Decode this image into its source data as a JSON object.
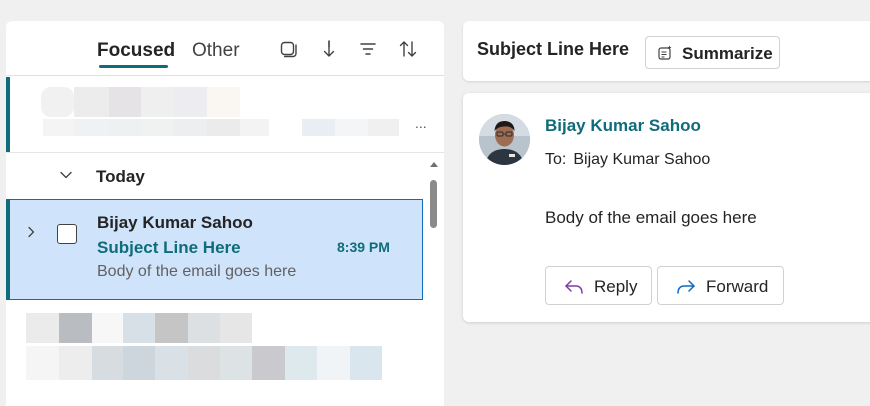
{
  "list": {
    "tabs": [
      {
        "label": "Focused",
        "active": true
      },
      {
        "label": "Other",
        "active": false
      }
    ],
    "toolbar_icons": [
      "select-mode-icon",
      "jump-down-icon",
      "filter-icon",
      "sort-icon"
    ],
    "group": {
      "label": "Today",
      "expanded": true
    },
    "selected_message": {
      "sender": "Bijay Kumar Sahoo",
      "subject": "Subject Line Here",
      "time": "8:39 PM",
      "preview": "Body of the email goes here"
    },
    "blurred_preview_more": "..."
  },
  "reading_pane": {
    "subject": "Subject Line Here",
    "summarize_label": "Summarize",
    "sender": "Bijay Kumar Sahoo",
    "to_label": "To:",
    "to_value": "Bijay Kumar Sahoo",
    "body": "Body of the email goes here",
    "reply_label": "Reply",
    "forward_label": "Forward"
  },
  "colors": {
    "accent": "#0f6c7a",
    "selected_bg": "#cfe4fa",
    "selected_border": "#0f6cbd",
    "app_bg": "#f0f0f0"
  }
}
